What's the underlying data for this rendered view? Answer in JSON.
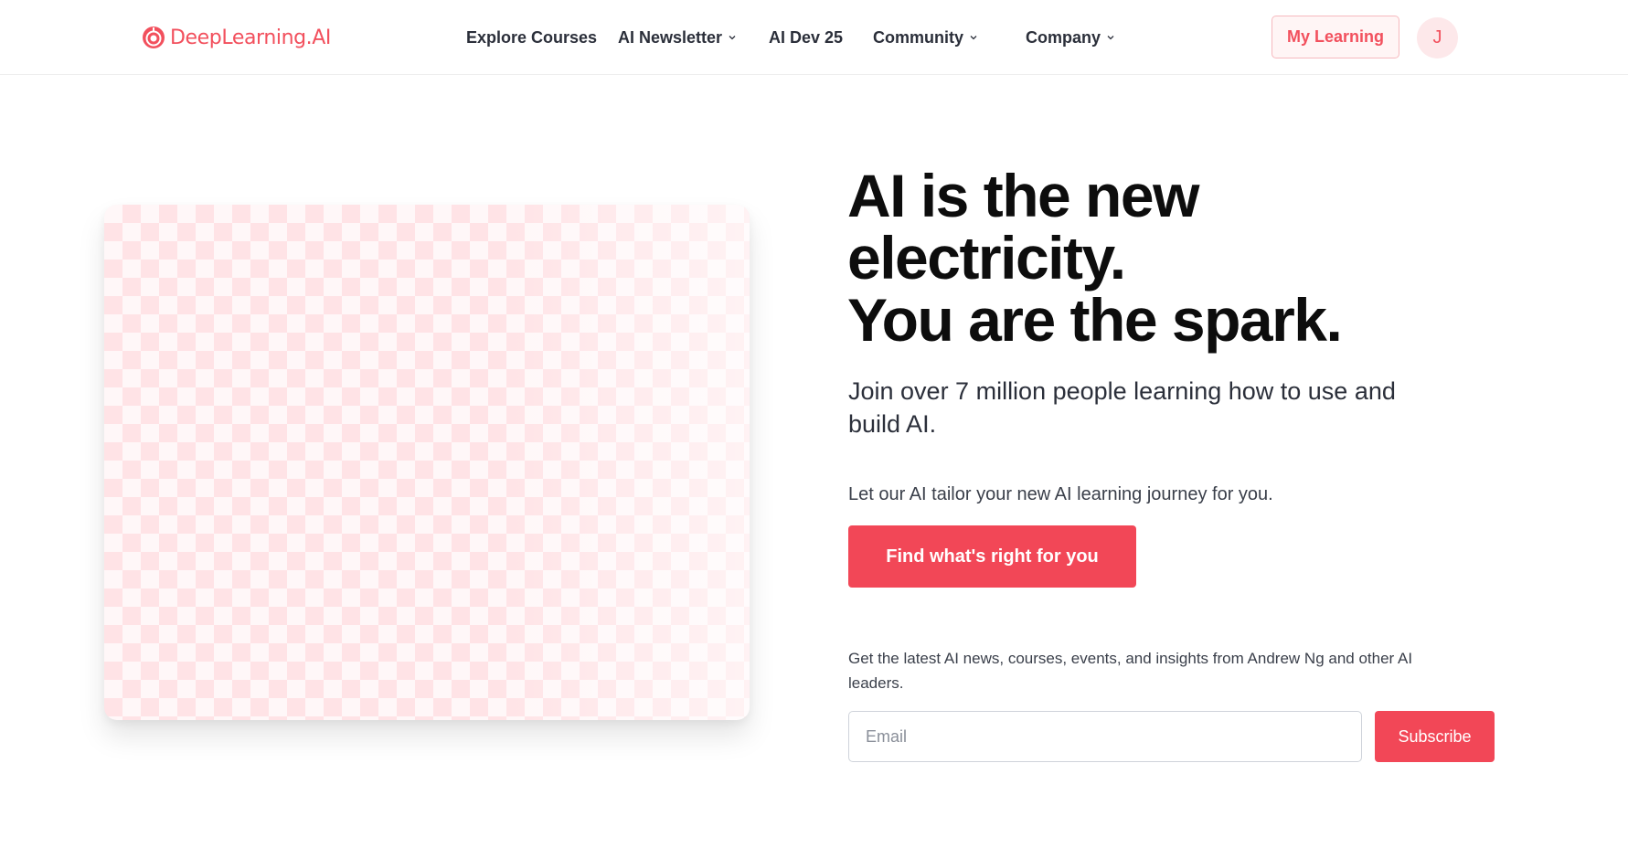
{
  "brand": {
    "name": "DeepLearning.AI",
    "accent_color": "#f2505d",
    "logo_icon": "deeplearning-logo-icon"
  },
  "nav": {
    "items": [
      {
        "label": "Explore Courses",
        "has_dropdown": false
      },
      {
        "label": "AI Newsletter",
        "has_dropdown": true
      },
      {
        "label": "AI Dev 25",
        "has_dropdown": false
      },
      {
        "label": "Community",
        "has_dropdown": true
      },
      {
        "label": "Company",
        "has_dropdown": true
      }
    ],
    "my_learning_label": "My Learning",
    "avatar_initial": "J"
  },
  "hero": {
    "headline_lines": [
      "AI is the new",
      "electricity.",
      "You are the spark."
    ],
    "subhead": "Join over 7 million people learning how to use and build AI.",
    "tailor_text": "Let our AI tailor your new AI learning journey for you.",
    "cta_label": "Find what's right for you",
    "cta_color": "#f24757"
  },
  "newsletter": {
    "description": "Get the latest AI news, courses, events, and insights from Andrew Ng and other AI leaders.",
    "email_placeholder": "Email",
    "email_value": "",
    "subscribe_label": "Subscribe"
  }
}
